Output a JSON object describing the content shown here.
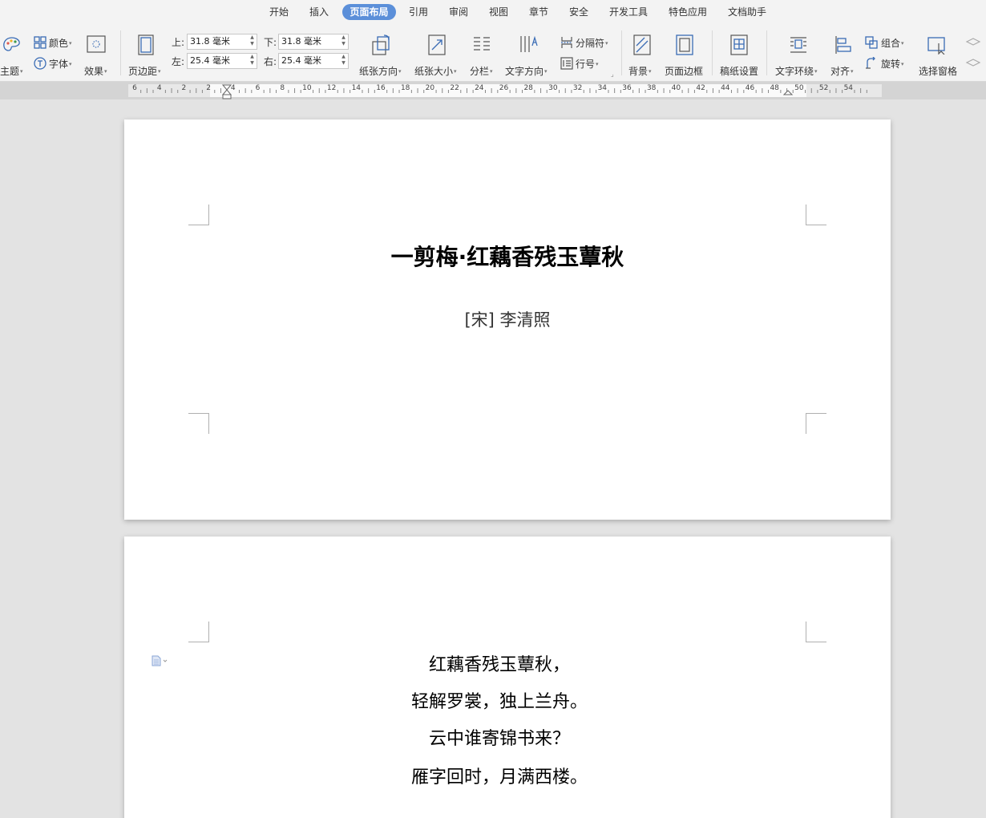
{
  "menu": {
    "tabs": [
      {
        "id": "start",
        "label": "开始"
      },
      {
        "id": "insert",
        "label": "插入"
      },
      {
        "id": "page-layout",
        "label": "页面布局",
        "active": true
      },
      {
        "id": "references",
        "label": "引用"
      },
      {
        "id": "review",
        "label": "审阅"
      },
      {
        "id": "view",
        "label": "视图"
      },
      {
        "id": "chapter",
        "label": "章节"
      },
      {
        "id": "security",
        "label": "安全"
      },
      {
        "id": "developer",
        "label": "开发工具"
      },
      {
        "id": "special",
        "label": "特色应用"
      },
      {
        "id": "assistant",
        "label": "文档助手"
      }
    ]
  },
  "ribbon": {
    "theme": "主题",
    "colors": "颜色",
    "fonts": "字体",
    "effects": "效果",
    "margins": "页边距",
    "margin_top_label": "上:",
    "margin_top_value": "31.8 毫米",
    "margin_bottom_label": "下:",
    "margin_bottom_value": "31.8 毫米",
    "margin_left_label": "左:",
    "margin_left_value": "25.4 毫米",
    "margin_right_label": "右:",
    "margin_right_value": "25.4 毫米",
    "orientation": "纸张方向",
    "size": "纸张大小",
    "columns": "分栏",
    "text_direction": "文字方向",
    "breaks": "分隔符",
    "line_numbers": "行号",
    "background": "背景",
    "page_border": "页面边框",
    "manuscript": "稿纸设置",
    "wrap_text": "文字环绕",
    "align": "对齐",
    "group": "组合",
    "rotate": "旋转",
    "selection_pane": "选择窗格"
  },
  "ruler": {
    "numbers": [
      "6",
      "4",
      "2",
      "2",
      "4",
      "6",
      "8",
      "10",
      "12",
      "14",
      "16",
      "18",
      "20",
      "22",
      "24",
      "26",
      "28",
      "30",
      "32",
      "34",
      "36",
      "38",
      "40",
      "42",
      "44",
      "46",
      "48",
      "50",
      "52",
      "54"
    ]
  },
  "document": {
    "title": "一剪梅·红藕香残玉蕈秋",
    "author": "[宋]  李清照",
    "lines": [
      "红藕香残玉蕈秋，",
      "轻解罗裳，独上兰舟。",
      "云中谁寄锦书来？",
      "雁字回时，月满西楼。"
    ]
  }
}
